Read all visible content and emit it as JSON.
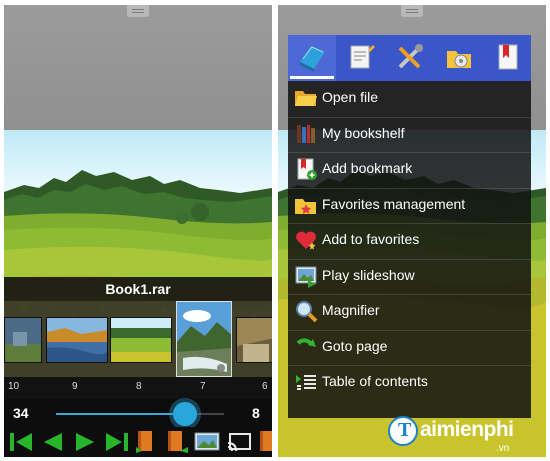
{
  "reader": {
    "book_title": "Book1.rar",
    "thumbnail_page_numbers": [
      "10",
      "9",
      "8",
      "7",
      "6"
    ],
    "current_page": "34",
    "max_page": "8",
    "slider_fraction": 0.77,
    "controls": [
      {
        "icon": "first-page-icon"
      },
      {
        "icon": "previous-page-icon"
      },
      {
        "icon": "next-page-icon"
      },
      {
        "icon": "last-page-icon"
      },
      {
        "icon": "previous-book-icon"
      },
      {
        "icon": "next-book-icon"
      },
      {
        "icon": "image-view-icon"
      },
      {
        "icon": "cast-icon"
      },
      {
        "icon": "book-icon"
      }
    ]
  },
  "menu": {
    "tabs": [
      {
        "icon": "books-tab-icon",
        "active": true
      },
      {
        "icon": "notes-tab-icon",
        "active": false
      },
      {
        "icon": "tools-tab-icon",
        "active": false
      },
      {
        "icon": "folder-settings-tab-icon",
        "active": false
      },
      {
        "icon": "bookmark-tab-icon",
        "active": false
      }
    ],
    "items": [
      {
        "label": "Open file",
        "icon": "folder-open-icon"
      },
      {
        "label": "My bookshelf",
        "icon": "bookshelf-icon"
      },
      {
        "label": "Add bookmark",
        "icon": "add-bookmark-icon"
      },
      {
        "label": "Favorites management",
        "icon": "favorites-folder-icon"
      },
      {
        "label": "Add to favorites",
        "icon": "heart-add-icon"
      },
      {
        "label": "Play slideshow",
        "icon": "slideshow-icon"
      },
      {
        "label": "Magnifier",
        "icon": "magnifier-icon"
      },
      {
        "label": "Goto page",
        "icon": "goto-arrow-icon"
      },
      {
        "label": "Table of contents",
        "icon": "toc-icon"
      }
    ]
  },
  "watermark": {
    "logo_letter": "T",
    "text": "aimienphi",
    "sub": ".vn"
  },
  "colors": {
    "menu_tab_bar": "#3b56c8",
    "slider_accent": "#2aa6db",
    "control_green": "#27b52a",
    "watermark_blue": "#1b82c8"
  }
}
